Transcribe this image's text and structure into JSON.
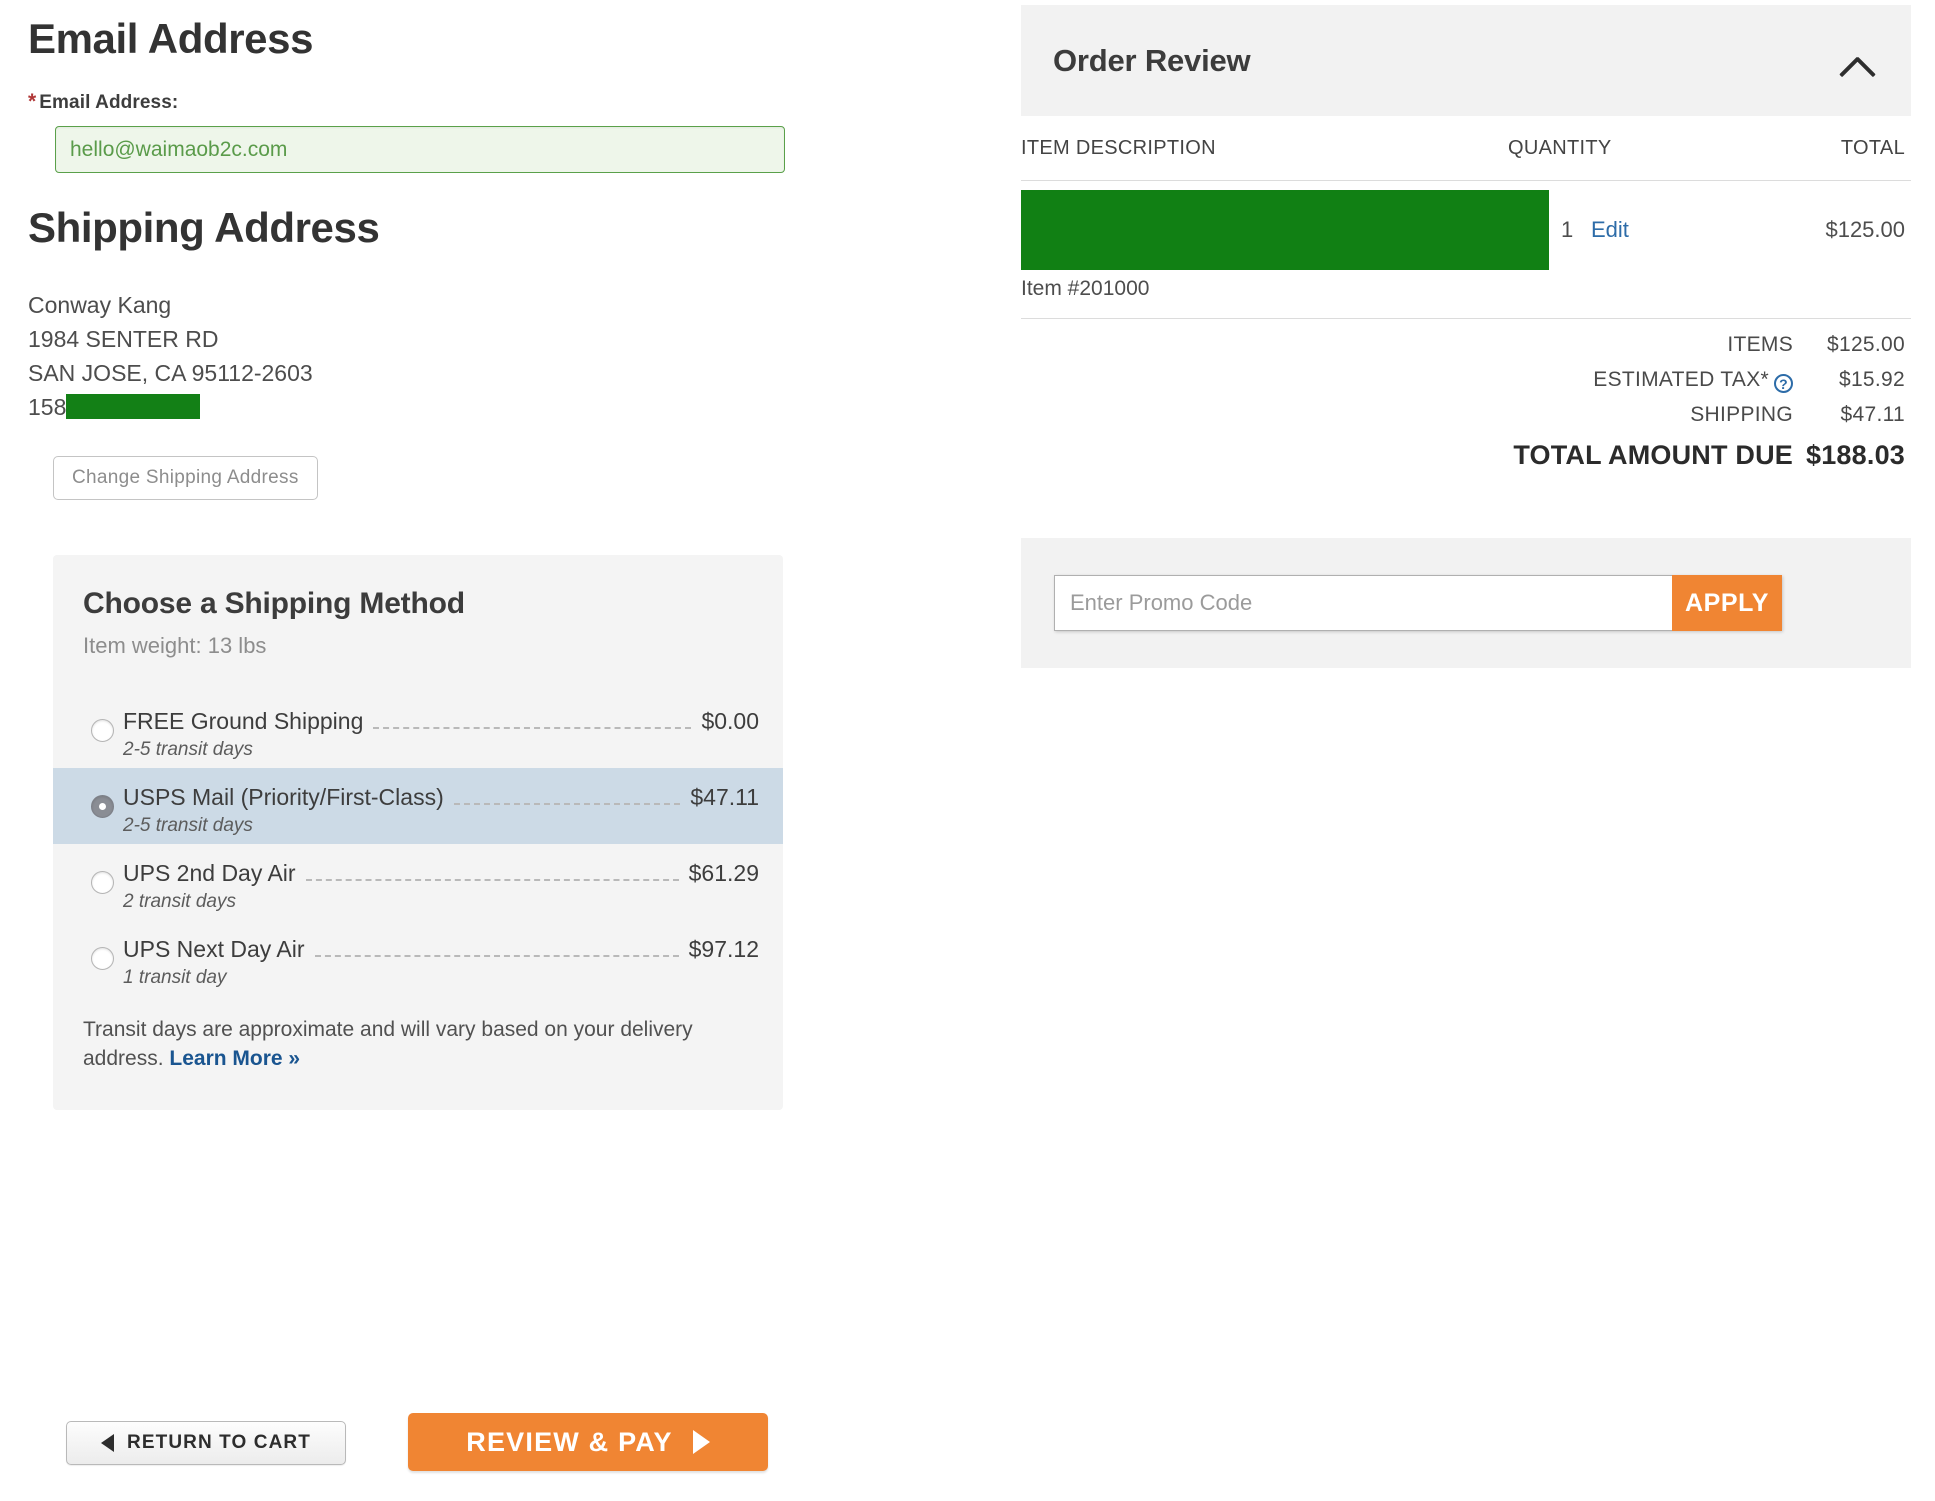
{
  "email_section": {
    "heading": "Email Address",
    "label": "Email Address:",
    "required_marker": "*",
    "value": "hello@waimaob2c.com"
  },
  "shipping_address": {
    "heading": "Shipping Address",
    "name": "Conway Kang",
    "street": "1984 SENTER RD",
    "city_state_zip": "SAN JOSE, CA 95112-2603",
    "phone_prefix": "158",
    "change_button": "Change Shipping Address"
  },
  "shipping_method": {
    "title": "Choose a Shipping Method",
    "weight": "Item weight: 13 lbs",
    "options": [
      {
        "name": "FREE Ground Shipping",
        "transit": "2-5 transit days",
        "price": "$0.00",
        "selected": false
      },
      {
        "name": "USPS Mail (Priority/First-Class)",
        "transit": "2-5 transit days",
        "price": "$47.11",
        "selected": true
      },
      {
        "name": "UPS 2nd Day Air",
        "transit": "2 transit days",
        "price": "$61.29",
        "selected": false
      },
      {
        "name": "UPS Next Day Air",
        "transit": "1 transit day",
        "price": "$97.12",
        "selected": false
      }
    ],
    "note": "Transit days are approximate and will vary based on your delivery address.",
    "learn_more": "Learn More »"
  },
  "actions": {
    "return_to_cart": "RETURN TO CART",
    "review_and_pay": "REVIEW & PAY"
  },
  "order_review": {
    "title": "Order Review",
    "collapse_icon": "chevron-up",
    "columns": {
      "description": "ITEM DESCRIPTION",
      "quantity": "QUANTITY",
      "total": "TOTAL"
    },
    "item": {
      "name_redacted": true,
      "quantity": "1",
      "edit_label": "Edit",
      "total": "$125.00",
      "sku": "Item #201000"
    },
    "totals": [
      {
        "label": "ITEMS",
        "value": "$125.00",
        "help": false
      },
      {
        "label": "ESTIMATED TAX*",
        "value": "$15.92",
        "help": true
      },
      {
        "label": "SHIPPING",
        "value": "$47.11",
        "help": false
      }
    ],
    "grand_total": {
      "label": "TOTAL AMOUNT DUE",
      "value": "$188.03"
    },
    "help_glyph": "?"
  },
  "promo": {
    "placeholder": "Enter Promo Code",
    "value": "",
    "apply_label": "APPLY"
  },
  "colors": {
    "accent_orange": "#f08533",
    "link_blue": "#2d6ca8",
    "redaction_green": "#118014",
    "selected_row": "#ccdae6",
    "panel_gray": "#f2f2f2"
  }
}
